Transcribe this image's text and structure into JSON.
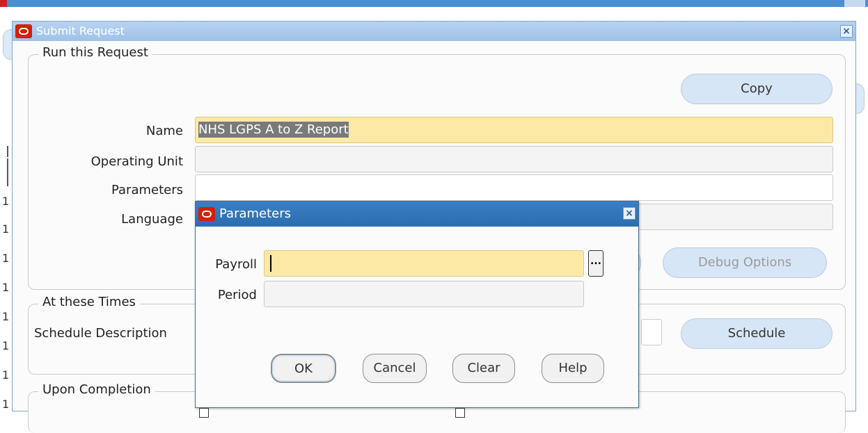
{
  "background": {
    "left_numbers": [
      "1",
      "1",
      "1",
      "1",
      "1",
      "1",
      "1",
      "1",
      "1"
    ]
  },
  "dialog": {
    "title": "Submit Request",
    "close_glyph": "×",
    "run_group": {
      "label": "Run this Request",
      "copy_button": "Copy",
      "name_label": "Name",
      "name_value": "NHS LGPS A to Z Report",
      "operating_unit_label": "Operating Unit",
      "operating_unit_value": "",
      "parameters_label": "Parameters",
      "parameters_value": "",
      "language_label": "Language",
      "language_value": "",
      "debug_button": "Debug Options"
    },
    "times_group": {
      "label": "At these Times",
      "schedule_desc_label": "Schedule Description",
      "schedule_button": "Schedule"
    },
    "completion_group": {
      "label": "Upon Completion"
    }
  },
  "modal": {
    "title": "Parameters",
    "close_glyph": "×",
    "payroll_label": "Payroll",
    "payroll_value": "",
    "lov_glyph": "...",
    "period_label": "Period",
    "period_value": "",
    "buttons": {
      "ok": "OK",
      "cancel": "Cancel",
      "clear": "Clear",
      "help": "Help"
    }
  },
  "colors": {
    "required_field": "#fde9a6",
    "title_bar_active": "#2b6db0",
    "title_bar_inactive": "#9fc2e8",
    "button_fill": "#d6e6f6",
    "oracle_red": "#d81e05"
  },
  "icons": {
    "app": "oracle-logo-icon",
    "close": "close-icon",
    "lov": "ellipsis-icon"
  }
}
